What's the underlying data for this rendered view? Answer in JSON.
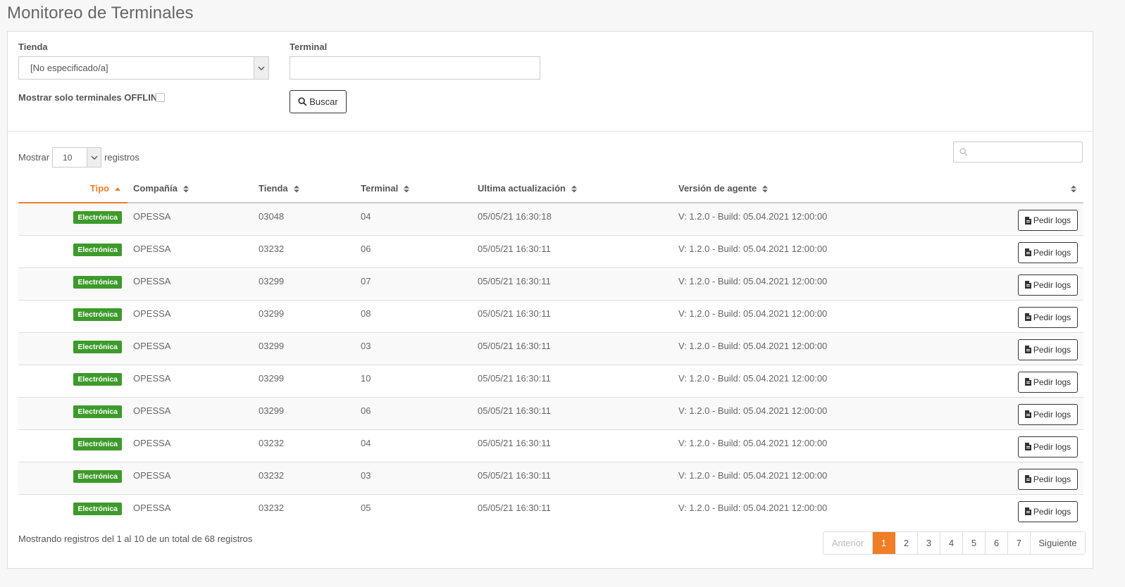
{
  "page": {
    "title": "Monitoreo de Terminales"
  },
  "filters": {
    "tienda_label": "Tienda",
    "tienda_value": "[No especificado/a]",
    "terminal_label": "Terminal",
    "terminal_value": "",
    "offline_label": "Mostrar solo terminales OFFLINE",
    "search_button": "Buscar"
  },
  "table_controls": {
    "show_label": "Mostrar",
    "page_size": "10",
    "records_label": "registros",
    "search_value": ""
  },
  "table": {
    "columns": [
      "Tipo",
      "Compañía",
      "Tienda",
      "Terminal",
      "Ultima actualización",
      "Versión de agente",
      ""
    ],
    "sorted_column": "Tipo",
    "action_label": "Pedir logs",
    "rows": [
      {
        "tipo": "Electrónica",
        "compania": "OPESSA",
        "tienda": "03048",
        "terminal": "04",
        "actualizacion": "05/05/21 16:30:18",
        "version": "V: 1.2.0 - Build: 05.04.2021 12:00:00"
      },
      {
        "tipo": "Electrónica",
        "compania": "OPESSA",
        "tienda": "03232",
        "terminal": "06",
        "actualizacion": "05/05/21 16:30:11",
        "version": "V: 1.2.0 - Build: 05.04.2021 12:00:00"
      },
      {
        "tipo": "Electrónica",
        "compania": "OPESSA",
        "tienda": "03299",
        "terminal": "07",
        "actualizacion": "05/05/21 16:30:11",
        "version": "V: 1.2.0 - Build: 05.04.2021 12:00:00"
      },
      {
        "tipo": "Electrónica",
        "compania": "OPESSA",
        "tienda": "03299",
        "terminal": "08",
        "actualizacion": "05/05/21 16:30:11",
        "version": "V: 1.2.0 - Build: 05.04.2021 12:00:00"
      },
      {
        "tipo": "Electrónica",
        "compania": "OPESSA",
        "tienda": "03299",
        "terminal": "03",
        "actualizacion": "05/05/21 16:30:11",
        "version": "V: 1.2.0 - Build: 05.04.2021 12:00:00"
      },
      {
        "tipo": "Electrónica",
        "compania": "OPESSA",
        "tienda": "03299",
        "terminal": "10",
        "actualizacion": "05/05/21 16:30:11",
        "version": "V: 1.2.0 - Build: 05.04.2021 12:00:00"
      },
      {
        "tipo": "Electrónica",
        "compania": "OPESSA",
        "tienda": "03299",
        "terminal": "06",
        "actualizacion": "05/05/21 16:30:11",
        "version": "V: 1.2.0 - Build: 05.04.2021 12:00:00"
      },
      {
        "tipo": "Electrónica",
        "compania": "OPESSA",
        "tienda": "03232",
        "terminal": "04",
        "actualizacion": "05/05/21 16:30:11",
        "version": "V: 1.2.0 - Build: 05.04.2021 12:00:00"
      },
      {
        "tipo": "Electrónica",
        "compania": "OPESSA",
        "tienda": "03232",
        "terminal": "03",
        "actualizacion": "05/05/21 16:30:11",
        "version": "V: 1.2.0 - Build: 05.04.2021 12:00:00"
      },
      {
        "tipo": "Electrónica",
        "compania": "OPESSA",
        "tienda": "03232",
        "terminal": "05",
        "actualizacion": "05/05/21 16:30:11",
        "version": "V: 1.2.0 - Build: 05.04.2021 12:00:00"
      }
    ]
  },
  "footer": {
    "info": "Mostrando registros del 1 al 10 de un total de 68 registros",
    "pagination": {
      "previous": "Anterior",
      "pages": [
        "1",
        "2",
        "3",
        "4",
        "5",
        "6",
        "7"
      ],
      "active_page": "1",
      "next": "Siguiente"
    }
  },
  "colors": {
    "accent": "#f07e26",
    "badge": "#3d9a2b"
  },
  "icons": [
    "chevron-down-icon",
    "search-icon",
    "sort-icon",
    "sort-asc-icon",
    "file-icon"
  ]
}
